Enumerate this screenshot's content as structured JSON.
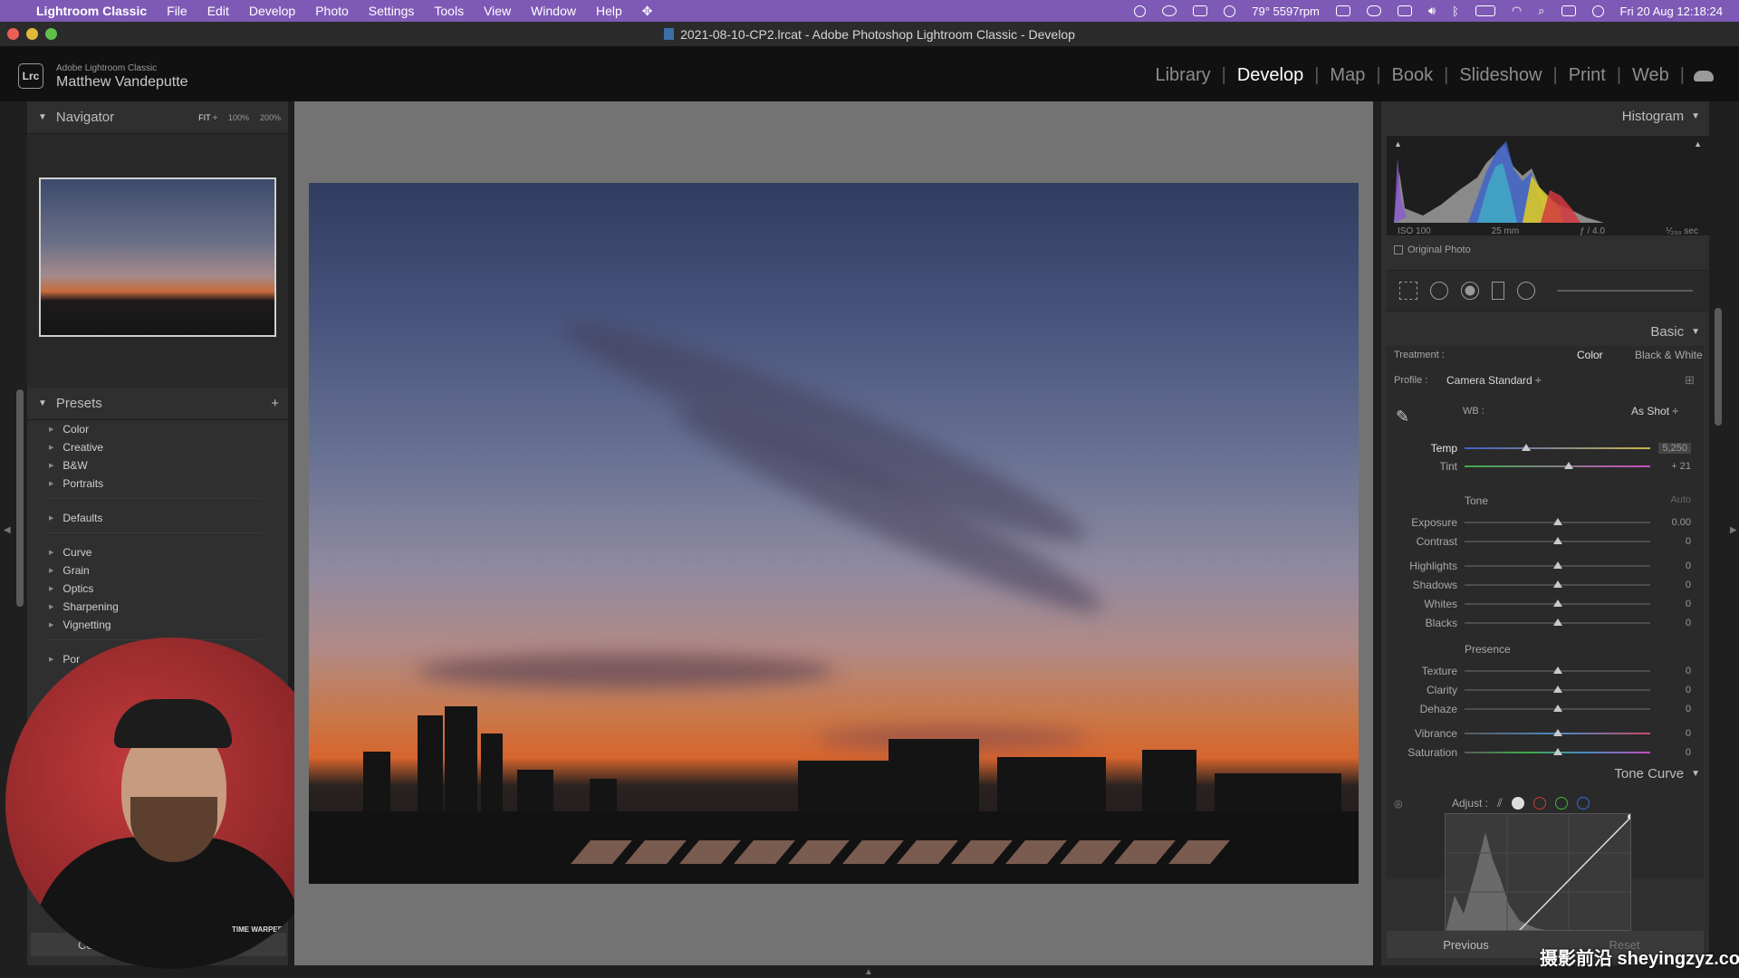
{
  "menubar": {
    "app": "Lightroom Classic",
    "items": [
      "File",
      "Edit",
      "Develop",
      "Photo",
      "Settings",
      "Tools",
      "View",
      "Window",
      "Help"
    ],
    "temp_status": "79° 5597rpm",
    "datetime": "Fri 20 Aug  12:18:24"
  },
  "window": {
    "title": "2021-08-10-CP2.lrcat - Adobe Photoshop Lightroom Classic - Develop"
  },
  "brand": {
    "badge": "Lrc",
    "small": "Adobe Lightroom Classic",
    "user": "Matthew Vandeputte"
  },
  "modules": [
    "Library",
    "Develop",
    "Map",
    "Book",
    "Slideshow",
    "Print",
    "Web"
  ],
  "active_module": "Develop",
  "navigator": {
    "title": "Navigator",
    "zoom": [
      "FIT ÷",
      "100%",
      "200%"
    ]
  },
  "presets": {
    "title": "Presets",
    "groups": [
      [
        "Color",
        "Creative",
        "B&W",
        "Portraits"
      ],
      [
        "Defaults"
      ],
      [
        "Curve",
        "Grain",
        "Optics",
        "Sharpening",
        "Vignetting"
      ],
      [
        "Por"
      ]
    ],
    "copy_label": "Co"
  },
  "histogram": {
    "title": "Histogram",
    "iso": "ISO 100",
    "focal": "25 mm",
    "aperture": "ƒ / 4.0",
    "shutter": "⅟₂₅₀ sec",
    "original_photo": "Original Photo"
  },
  "basic": {
    "title": "Basic",
    "treatment_label": "Treatment :",
    "treatment_color": "Color",
    "treatment_bw": "Black & White",
    "profile_label": "Profile :",
    "profile_value": "Camera Standard ÷",
    "wb_label": "WB :",
    "wb_value": "As Shot ÷",
    "tone_label": "Tone",
    "auto_label": "Auto",
    "presence_label": "Presence",
    "sliders": {
      "temp": {
        "label": "Temp",
        "value": "5,250",
        "pos": 0.33
      },
      "tint": {
        "label": "Tint",
        "value": "+ 21",
        "pos": 0.56
      },
      "exposure": {
        "label": "Exposure",
        "value": "0.00",
        "pos": 0.5
      },
      "contrast": {
        "label": "Contrast",
        "value": "0",
        "pos": 0.5
      },
      "highlights": {
        "label": "Highlights",
        "value": "0",
        "pos": 0.5
      },
      "shadows": {
        "label": "Shadows",
        "value": "0",
        "pos": 0.5
      },
      "whites": {
        "label": "Whites",
        "value": "0",
        "pos": 0.5
      },
      "blacks": {
        "label": "Blacks",
        "value": "0",
        "pos": 0.5
      },
      "texture": {
        "label": "Texture",
        "value": "0",
        "pos": 0.5
      },
      "clarity": {
        "label": "Clarity",
        "value": "0",
        "pos": 0.5
      },
      "dehaze": {
        "label": "Dehaze",
        "value": "0",
        "pos": 0.5
      },
      "vibrance": {
        "label": "Vibrance",
        "value": "0",
        "pos": 0.5
      },
      "saturation": {
        "label": "Saturation",
        "value": "0",
        "pos": 0.5
      }
    }
  },
  "tone_curve": {
    "title": "Tone Curve",
    "adjust_label": "Adjust :"
  },
  "bottom": {
    "previous": "Previous",
    "reset": "Reset"
  },
  "watermark": "摄影前沿 sheyingzyz.com",
  "webcam_logo": "TIME WARPER",
  "colors": {
    "menubar": "#7e5ab6",
    "panel": "#2f2f2f",
    "canvas": "#737373"
  }
}
